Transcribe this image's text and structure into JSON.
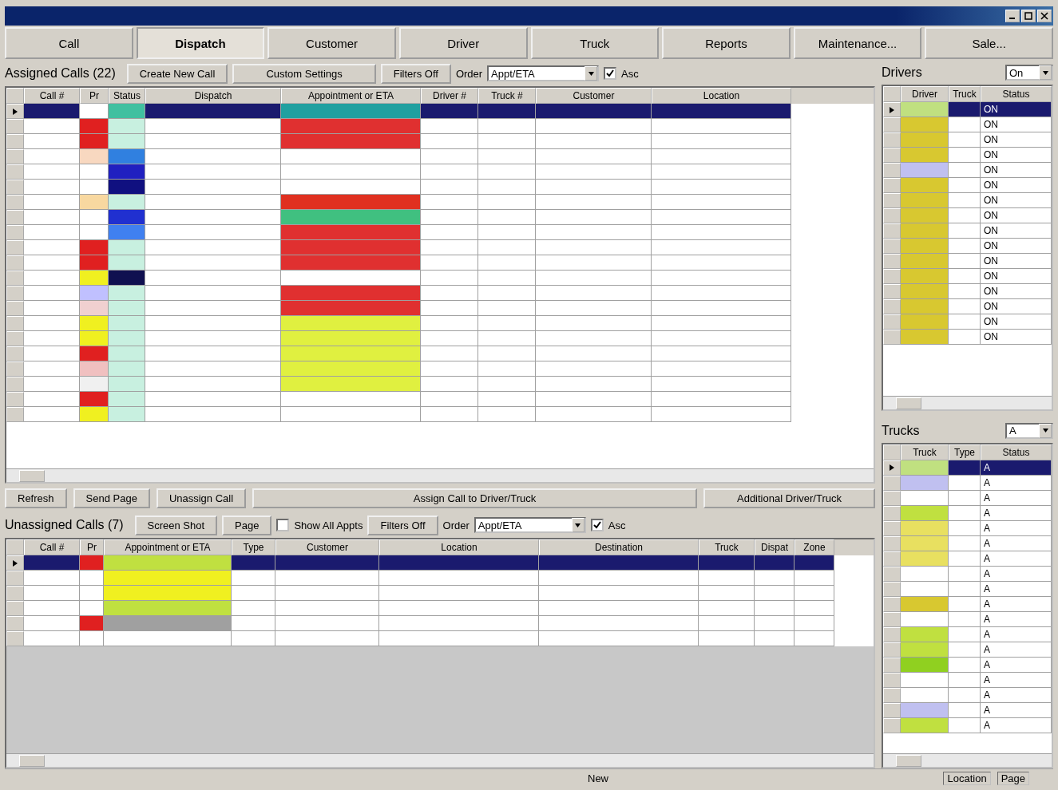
{
  "tabs": [
    {
      "label": "Call",
      "selected": false
    },
    {
      "label": "Dispatch",
      "selected": true
    },
    {
      "label": "Customer",
      "selected": false
    },
    {
      "label": "Driver",
      "selected": false
    },
    {
      "label": "Truck",
      "selected": false
    },
    {
      "label": "Reports",
      "selected": false
    },
    {
      "label": "Maintenance...",
      "selected": false
    },
    {
      "label": "Sale...",
      "selected": false
    }
  ],
  "assigned": {
    "title": "Assigned Calls (22)",
    "buttons": [
      "Create New Call",
      "Custom Settings",
      "Filters Off"
    ],
    "order_label": "Order",
    "order_value": "Appt/ETA",
    "asc": {
      "label": "Asc",
      "checked": true
    },
    "columns": [
      {
        "label": "Call #",
        "kind": "plain"
      },
      {
        "label": "Pr",
        "kind": "pr"
      },
      {
        "label": "Status",
        "kind": "status"
      },
      {
        "label": "Dispatch",
        "kind": "plain"
      },
      {
        "label": "Appointment or ETA",
        "kind": "appt"
      },
      {
        "label": "Driver #",
        "kind": "plain"
      },
      {
        "label": "Truck #",
        "kind": "plain"
      },
      {
        "label": "Customer",
        "kind": "plain"
      },
      {
        "label": "Location",
        "kind": "plain"
      }
    ],
    "rows": [
      {
        "selected": true,
        "pr": {
          "color": "#ffffff"
        },
        "status": {
          "color": "#40c0a0"
        },
        "appt": {
          "color": "#20a0a0"
        }
      },
      {
        "selected": false,
        "pr": {
          "color": "#e02020"
        },
        "status": {
          "color": "#c8f0e0"
        },
        "appt": {
          "color": "#e03030"
        }
      },
      {
        "selected": false,
        "pr": {
          "color": "#e02020"
        },
        "status": {
          "color": "#c8f0e0"
        },
        "appt": {
          "color": "#e03030"
        }
      },
      {
        "selected": false,
        "pr": {
          "color": "#f8d8c0"
        },
        "status": {
          "color": "#3080e0"
        },
        "appt": {
          "color": "#ffffff"
        }
      },
      {
        "selected": false,
        "pr": {
          "color": "#ffffff"
        },
        "status": {
          "color": "#2020c0"
        },
        "appt": {
          "color": "#ffffff"
        }
      },
      {
        "selected": false,
        "pr": {
          "color": "#ffffff"
        },
        "status": {
          "color": "#101080"
        },
        "appt": {
          "color": "#ffffff"
        }
      },
      {
        "selected": false,
        "pr": {
          "color": "#f8d8a0"
        },
        "status": {
          "color": "#c8f0e0"
        },
        "appt": {
          "color": "#e03020"
        }
      },
      {
        "selected": false,
        "pr": {
          "color": "#ffffff"
        },
        "status": {
          "color": "#2030d0"
        },
        "appt": {
          "color": "#40c080"
        }
      },
      {
        "selected": false,
        "pr": {
          "color": "#ffffff"
        },
        "status": {
          "color": "#4080f0"
        },
        "appt": {
          "color": "#e03030"
        }
      },
      {
        "selected": false,
        "pr": {
          "color": "#e02020"
        },
        "status": {
          "color": "#c8f0e0"
        },
        "appt": {
          "color": "#e03030"
        }
      },
      {
        "selected": false,
        "pr": {
          "color": "#e02020"
        },
        "status": {
          "color": "#c8f0e0"
        },
        "appt": {
          "color": "#e03030"
        }
      },
      {
        "selected": false,
        "pr": {
          "color": "#f0f020"
        },
        "status": {
          "color": "#101050"
        },
        "appt": {
          "color": "#ffffff"
        }
      },
      {
        "selected": false,
        "pr": {
          "color": "#c0c0ff"
        },
        "status": {
          "color": "#c8f0e0"
        },
        "appt": {
          "color": "#e03030"
        }
      },
      {
        "selected": false,
        "pr": {
          "color": "#f0d0d0"
        },
        "status": {
          "color": "#c8f0e0"
        },
        "appt": {
          "color": "#e03030"
        }
      },
      {
        "selected": false,
        "pr": {
          "color": "#f0f020"
        },
        "status": {
          "color": "#c8f0e0"
        },
        "appt": {
          "color": "#e0f040"
        }
      },
      {
        "selected": false,
        "pr": {
          "color": "#f0f020"
        },
        "status": {
          "color": "#c8f0e0"
        },
        "appt": {
          "color": "#e0f040"
        }
      },
      {
        "selected": false,
        "pr": {
          "color": "#e02020"
        },
        "status": {
          "color": "#c8f0e0"
        },
        "appt": {
          "color": "#e0f040"
        }
      },
      {
        "selected": false,
        "pr": {
          "color": "#f0c0c0"
        },
        "status": {
          "color": "#c8f0e0"
        },
        "appt": {
          "color": "#e0f040"
        }
      },
      {
        "selected": false,
        "pr": {
          "color": "#f0f0f0"
        },
        "status": {
          "color": "#c8f0e0"
        },
        "appt": {
          "color": "#e0f040"
        }
      },
      {
        "selected": false,
        "pr": {
          "color": "#e02020"
        },
        "status": {
          "color": "#c8f0e0"
        },
        "appt": {
          "color": "#ffffff"
        }
      },
      {
        "selected": false,
        "pr": {
          "color": "#f0f020"
        },
        "status": {
          "color": "#c8f0e0"
        },
        "appt": {
          "color": "#ffffff"
        }
      }
    ]
  },
  "action_buttons": [
    "Refresh",
    "Send Page",
    "Unassign Call",
    "Assign Call to Driver/Truck",
    "Additional Driver/Truck"
  ],
  "unassigned": {
    "title": "Unassigned Calls (7)",
    "buttons": [
      "Screen Shot",
      "Page"
    ],
    "show_all": {
      "label": "Show All Appts",
      "checked": false
    },
    "filters": "Filters Off",
    "order_label": "Order",
    "order_value": "Appt/ETA",
    "asc": {
      "label": "Asc",
      "checked": true
    },
    "columns": [
      {
        "label": "Call #",
        "kind": "plain"
      },
      {
        "label": "Pr",
        "kind": "pr"
      },
      {
        "label": "Appointment or ETA",
        "kind": "appt"
      },
      {
        "label": "Type",
        "kind": "plain"
      },
      {
        "label": "Customer",
        "kind": "plain"
      },
      {
        "label": "Location",
        "kind": "plain"
      },
      {
        "label": "Destination",
        "kind": "plain"
      },
      {
        "label": "Truck",
        "kind": "plain"
      },
      {
        "label": "Dispat",
        "kind": "plain"
      },
      {
        "label": "Zone",
        "kind": "plain"
      }
    ],
    "rows": [
      {
        "selected": true,
        "pr": {
          "color": "#e02020"
        },
        "appt": {
          "color": "#c0e040"
        }
      },
      {
        "selected": false,
        "pr": {
          "color": "#ffffff"
        },
        "appt": {
          "color": "#f0f020"
        }
      },
      {
        "selected": false,
        "pr": {
          "color": "#ffffff"
        },
        "appt": {
          "color": "#f0f020"
        }
      },
      {
        "selected": false,
        "pr": {
          "color": "#ffffff"
        },
        "appt": {
          "color": "#c0e040"
        }
      },
      {
        "selected": false,
        "pr": {
          "color": "#e02020"
        },
        "appt": {
          "color": "#a0a0a0"
        }
      },
      {
        "selected": false,
        "pr": {
          "color": "#ffffff"
        },
        "appt": {
          "color": "#ffffff"
        }
      }
    ]
  },
  "drivers": {
    "title": "Drivers",
    "filter": "On",
    "columns": [
      "Driver",
      "Truck",
      "Status"
    ],
    "rows": [
      {
        "selected": true,
        "color": "#c0e080",
        "status": "ON"
      },
      {
        "selected": false,
        "color": "#d8c830",
        "status": "ON"
      },
      {
        "selected": false,
        "color": "#d8c830",
        "status": "ON"
      },
      {
        "selected": false,
        "color": "#d8c830",
        "status": "ON"
      },
      {
        "selected": false,
        "color": "#c0c0f0",
        "status": "ON"
      },
      {
        "selected": false,
        "color": "#d8c830",
        "status": "ON"
      },
      {
        "selected": false,
        "color": "#d8c830",
        "status": "ON"
      },
      {
        "selected": false,
        "color": "#d8c830",
        "status": "ON"
      },
      {
        "selected": false,
        "color": "#d8c830",
        "status": "ON"
      },
      {
        "selected": false,
        "color": "#d8c830",
        "status": "ON"
      },
      {
        "selected": false,
        "color": "#d8c830",
        "status": "ON"
      },
      {
        "selected": false,
        "color": "#d8c830",
        "status": "ON"
      },
      {
        "selected": false,
        "color": "#d8c830",
        "status": "ON"
      },
      {
        "selected": false,
        "color": "#d8c830",
        "status": "ON"
      },
      {
        "selected": false,
        "color": "#d8c830",
        "status": "ON"
      },
      {
        "selected": false,
        "color": "#d8c830",
        "status": "ON"
      }
    ]
  },
  "trucks": {
    "title": "Trucks",
    "filter": "A",
    "columns": [
      "Truck",
      "Type",
      "Status"
    ],
    "rows": [
      {
        "selected": true,
        "color": "#c0e080",
        "status": "A"
      },
      {
        "selected": false,
        "color": "#c0c0f0",
        "status": "A"
      },
      {
        "selected": false,
        "color": "#ffffff",
        "status": "A"
      },
      {
        "selected": false,
        "color": "#c0e040",
        "status": "A"
      },
      {
        "selected": false,
        "color": "#e8e060",
        "status": "A"
      },
      {
        "selected": false,
        "color": "#e8e060",
        "status": "A"
      },
      {
        "selected": false,
        "color": "#e8e060",
        "status": "A"
      },
      {
        "selected": false,
        "color": "#ffffff",
        "status": "A"
      },
      {
        "selected": false,
        "color": "#ffffff",
        "status": "A"
      },
      {
        "selected": false,
        "color": "#d8c830",
        "status": "A"
      },
      {
        "selected": false,
        "color": "#ffffff",
        "status": "A"
      },
      {
        "selected": false,
        "color": "#c0e040",
        "status": "A"
      },
      {
        "selected": false,
        "color": "#c0e040",
        "status": "A"
      },
      {
        "selected": false,
        "color": "#90d020",
        "status": "A"
      },
      {
        "selected": false,
        "color": "#ffffff",
        "status": "A"
      },
      {
        "selected": false,
        "color": "#ffffff",
        "status": "A"
      },
      {
        "selected": false,
        "color": "#c0c0f0",
        "status": "A"
      },
      {
        "selected": false,
        "color": "#c0e040",
        "status": "A"
      }
    ]
  },
  "status_bar": {
    "center": "New",
    "right": [
      "Location",
      "Page"
    ]
  }
}
